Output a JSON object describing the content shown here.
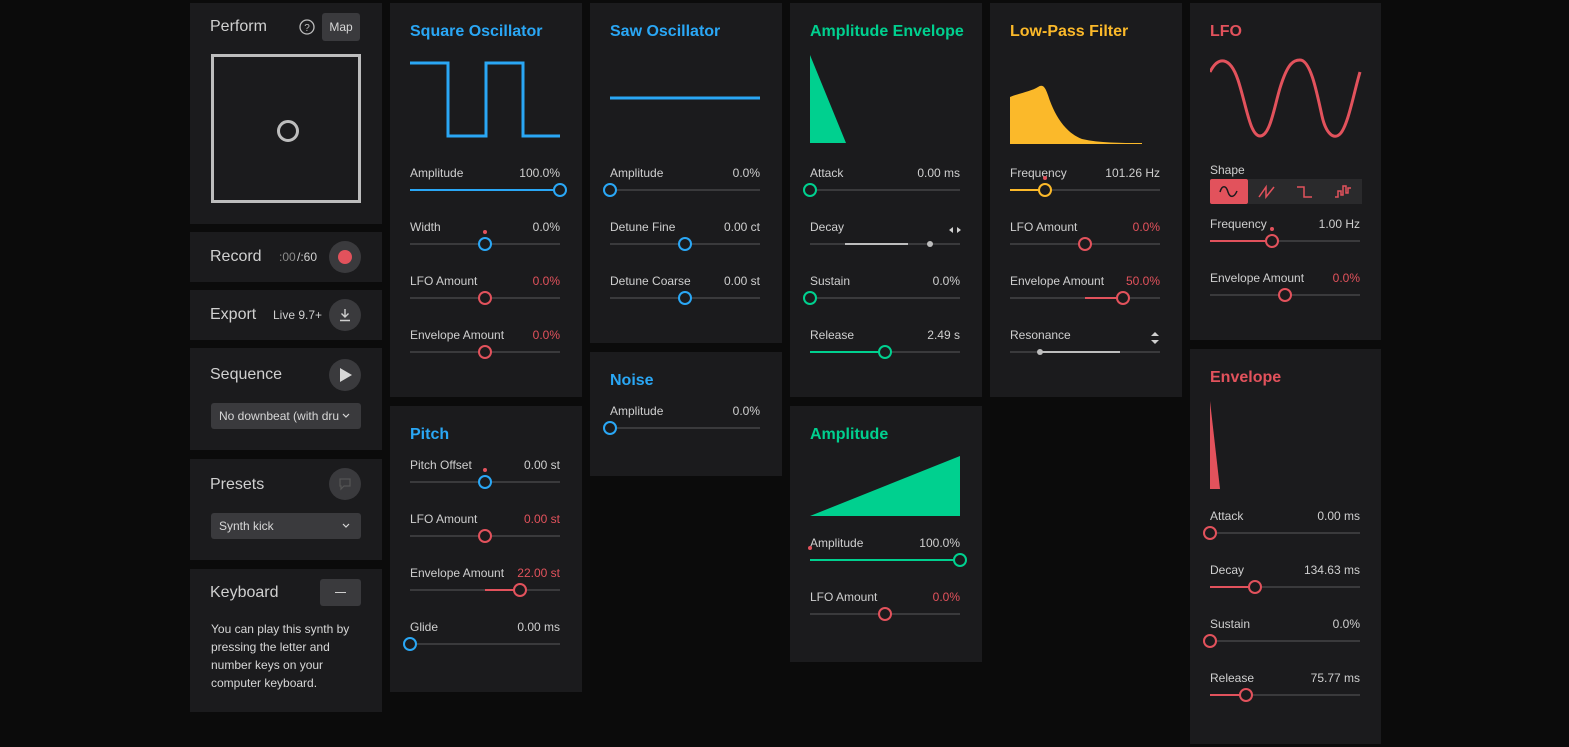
{
  "colors": {
    "blue": "#2aa7f5",
    "green": "#00d08f",
    "orange": "#fbb92a",
    "red": "#e2525c",
    "panel": "#1b1b1d",
    "track": "#3a3a3c"
  },
  "perform": {
    "title": "Perform",
    "help_icon": "question-circle-icon",
    "map_label": "Map"
  },
  "record": {
    "title": "Record",
    "time_current": ":00",
    "time_total": "/:60",
    "record_icon": "record-circle-icon"
  },
  "export": {
    "title": "Export",
    "version": "Live 9.7+",
    "download_icon": "download-icon"
  },
  "sequence": {
    "title": "Sequence",
    "play_icon": "play-icon",
    "selected": "No downbeat (with dru"
  },
  "presets": {
    "title": "Presets",
    "save_icon": "speech-bubble-icon",
    "selected": "Synth kick"
  },
  "keyboard": {
    "title": "Keyboard",
    "toggle_icon": "minus-icon",
    "description": "You can play this synth by pressing the letter and number keys on your computer keyboard."
  },
  "square_osc": {
    "title": "Square Oscillator",
    "params": [
      {
        "label": "Amplitude",
        "value": "100.0%",
        "level": 1.0
      },
      {
        "label": "Width",
        "value": "0.0%",
        "level": 0.5
      },
      {
        "label": "LFO Amount",
        "value": "0.0%",
        "level": 0.5
      },
      {
        "label": "Envelope Amount",
        "value": "0.0%",
        "level": 0.5
      }
    ]
  },
  "pitch": {
    "title": "Pitch",
    "params": [
      {
        "label": "Pitch Offset",
        "value": "0.00 st",
        "level": 0.5
      },
      {
        "label": "LFO Amount",
        "value": "0.00 st",
        "level": 0.5
      },
      {
        "label": "Envelope Amount",
        "value": "22.00 st",
        "level": 0.73
      },
      {
        "label": "Glide",
        "value": "0.00 ms",
        "level": 0.0
      }
    ]
  },
  "saw_osc": {
    "title": "Saw Oscillator",
    "params": [
      {
        "label": "Amplitude",
        "value": "0.0%",
        "level": 0.0
      },
      {
        "label": "Detune Fine",
        "value": "0.00 ct",
        "level": 0.5
      },
      {
        "label": "Detune Coarse",
        "value": "0.00 st",
        "level": 0.5
      }
    ]
  },
  "noise": {
    "title": "Noise",
    "params": [
      {
        "label": "Amplitude",
        "value": "0.0%",
        "level": 0.0
      }
    ]
  },
  "amp_env": {
    "title": "Amplitude Envelope",
    "params": [
      {
        "label": "Attack",
        "value": "0.00 ms",
        "level": 0.0
      },
      {
        "label": "Decay",
        "value": "",
        "level": 0.8
      },
      {
        "label": "Sustain",
        "value": "0.0%",
        "level": 0.0
      },
      {
        "label": "Release",
        "value": "2.49 s",
        "level": 0.5
      }
    ],
    "decay_icon": "left-right-arrows-icon"
  },
  "amplitude": {
    "title": "Amplitude",
    "params": [
      {
        "label": "Amplitude",
        "value": "100.0%",
        "level": 1.0
      },
      {
        "label": "LFO Amount",
        "value": "0.0%",
        "level": 0.5
      }
    ]
  },
  "lpf": {
    "title": "Low-Pass Filter",
    "params": [
      {
        "label": "Frequency",
        "value": "101.26 Hz",
        "level": 0.23
      },
      {
        "label": "LFO Amount",
        "value": "0.0%",
        "level": 0.5
      },
      {
        "label": "Envelope Amount",
        "value": "50.0%",
        "level": 0.75
      },
      {
        "label": "Resonance",
        "value": "",
        "level": 0.2
      }
    ],
    "resonance_icon": "up-down-arrows-icon"
  },
  "lfo": {
    "title": "LFO",
    "shape_label": "Shape",
    "shapes": [
      "sine-wave-icon",
      "saw-wave-icon",
      "square-wave-icon",
      "random-wave-icon"
    ],
    "params": [
      {
        "label": "Frequency",
        "value": "1.00 Hz",
        "level": 0.41
      },
      {
        "label": "Envelope Amount",
        "value": "0.0%",
        "level": 0.5
      }
    ]
  },
  "envelope": {
    "title": "Envelope",
    "params": [
      {
        "label": "Attack",
        "value": "0.00 ms",
        "level": 0.0
      },
      {
        "label": "Decay",
        "value": "134.63 ms",
        "level": 0.3
      },
      {
        "label": "Sustain",
        "value": "0.0%",
        "level": 0.0
      },
      {
        "label": "Release",
        "value": "75.77 ms",
        "level": 0.24
      }
    ]
  }
}
